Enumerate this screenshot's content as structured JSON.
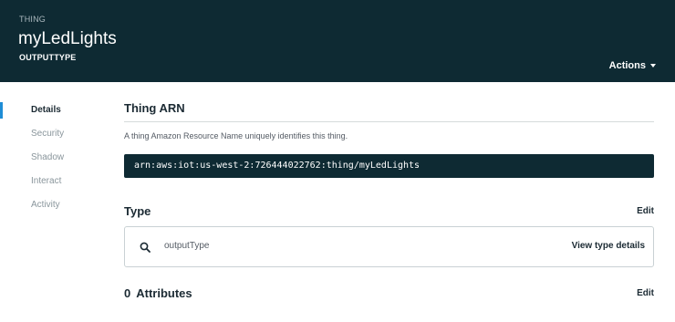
{
  "header": {
    "eyebrow": "THING",
    "title": "myLedLights",
    "subtitle": "OUTPUTTYPE",
    "actions_label": "Actions"
  },
  "sidebar": {
    "items": [
      {
        "label": "Details",
        "active": true
      },
      {
        "label": "Security",
        "active": false
      },
      {
        "label": "Shadow",
        "active": false
      },
      {
        "label": "Interact",
        "active": false
      },
      {
        "label": "Activity",
        "active": false
      }
    ]
  },
  "main": {
    "arn_section": {
      "title": "Thing ARN",
      "description": "A thing Amazon Resource Name uniquely identifies this thing.",
      "arn": "arn:aws:iot:us-west-2:726444022762:thing/myLedLights"
    },
    "type_section": {
      "title": "Type",
      "edit_label": "Edit",
      "type_value": "outputType",
      "view_details_label": "View type details"
    },
    "attributes_section": {
      "count": "0",
      "title": "Attributes",
      "edit_label": "Edit"
    }
  },
  "colors": {
    "header_bg": "#0e2a33",
    "accent": "#1f8dd6",
    "text_dark": "#1b2a33",
    "text_muted": "#8a969c"
  },
  "icons": {
    "actions_caret": "chevron-down-icon",
    "type_search": "search-icon"
  }
}
